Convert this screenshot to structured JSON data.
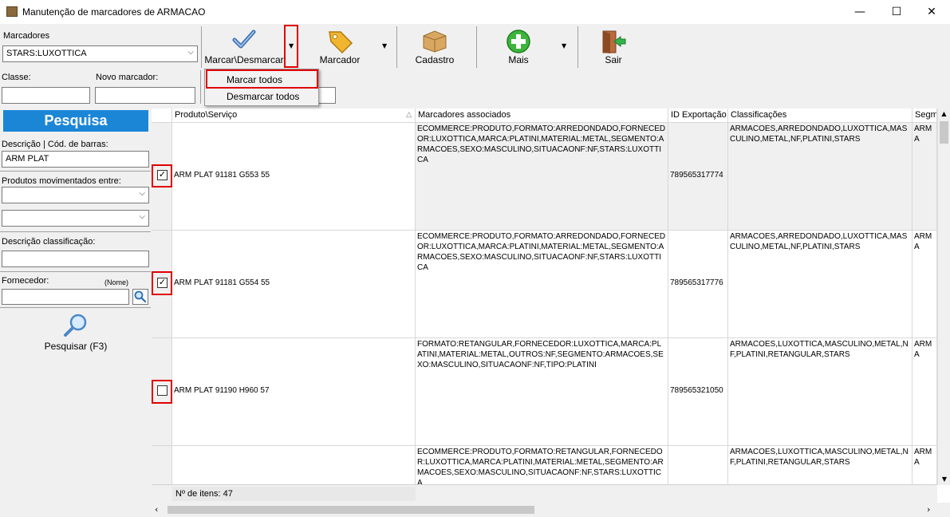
{
  "window": {
    "title": "Manutenção de marcadores de ARMACAO",
    "minimize": "—",
    "maximize": "☐",
    "close": "✕"
  },
  "marcadores": {
    "label": "Marcadores",
    "value": "STARS:LUXOTTICA"
  },
  "classe": {
    "label": "Classe:",
    "value": ""
  },
  "novo_marcador": {
    "label": "Novo marcador:",
    "value": ""
  },
  "toolbar": {
    "marcar": "Marcar\\Desmarcar",
    "marcador": "Marcador",
    "cadastro": "Cadastro",
    "mais": "Mais",
    "sair": "Sair"
  },
  "dropdown_menu": {
    "items": [
      "Marcar todos",
      "Desmarcar todos"
    ]
  },
  "sidebar": {
    "title": "Pesquisa",
    "descricao_label": "Descrição | Cód. de barras:",
    "descricao_value": "ARM PLAT",
    "movimentados_label": "Produtos movimentados entre:",
    "classificacao_label": "Descrição classificação:",
    "fornecedor_label": "Fornecedor:",
    "fornecedor_hint": "(Nome)",
    "search_button": "Pesquisar (F3)"
  },
  "grid": {
    "columns": [
      "Produto\\Serviço",
      "Marcadores associados",
      "ID Exportação",
      "Classificações",
      "Segm"
    ],
    "rows": [
      {
        "checked": true,
        "produto": "ARM PLAT 91181 G553 55",
        "marcadores": "ECOMMERCE:PRODUTO,FORMATO:ARREDONDADO,FORNECEDOR:LUXOTTICA,MARCA:PLATINI,MATERIAL:METAL,SEGMENTO:ARMACOES,SEXO:MASCULINO,SITUACAONF:NF,STARS:LUXOTTICA",
        "id": "789565317774",
        "classificacoes": "ARMACOES,ARREDONDADO,LUXOTTICA,MASCULINO,METAL,NF,PLATINI,STARS",
        "segm": "ARMA"
      },
      {
        "checked": true,
        "produto": "ARM PLAT 91181 G554 55",
        "marcadores": "ECOMMERCE:PRODUTO,FORMATO:ARREDONDADO,FORNECEDOR:LUXOTTICA,MARCA:PLATINI,MATERIAL:METAL,SEGMENTO:ARMACOES,SEXO:MASCULINO,SITUACAONF:NF,STARS:LUXOTTICA",
        "id": "789565317776",
        "classificacoes": "ARMACOES,ARREDONDADO,LUXOTTICA,MASCULINO,METAL,NF,PLATINI,STARS",
        "segm": "ARMA"
      },
      {
        "checked": false,
        "produto": "ARM PLAT 91190 H960 57",
        "marcadores": "FORMATO:RETANGULAR,FORNECEDOR:LUXOTTICA,MARCA:PLATINI,MATERIAL:METAL,OUTROS:NF,SEGMENTO:ARMACOES,SEXO:MASCULINO,SITUACAONF:NF,TIPO:PLATINI",
        "id": "789565321050",
        "classificacoes": "ARMACOES,LUXOTTICA,MASCULINO,METAL,NF,PLATINI,RETANGULAR,STARS",
        "segm": "ARMA"
      },
      {
        "checked": false,
        "produto": "",
        "marcadores": "ECOMMERCE:PRODUTO,FORMATO:RETANGULAR,FORNECEDOR:LUXOTTICA,MARCA:PLATINI,MATERIAL:METAL,SEGMENTO:ARMACOES,SEXO:MASCULINO,SITUACAONF:NF,STARS:LUXOTTICA",
        "id": "",
        "classificacoes": "ARMACOES,LUXOTTICA,MASCULINO,METAL,NF,PLATINI,RETANGULAR,STARS",
        "segm": "ARMA"
      }
    ],
    "footer": "Nº de itens: 47"
  },
  "colors": {
    "accent_blue": "#1c86d6",
    "highlight_red": "#e00000"
  }
}
